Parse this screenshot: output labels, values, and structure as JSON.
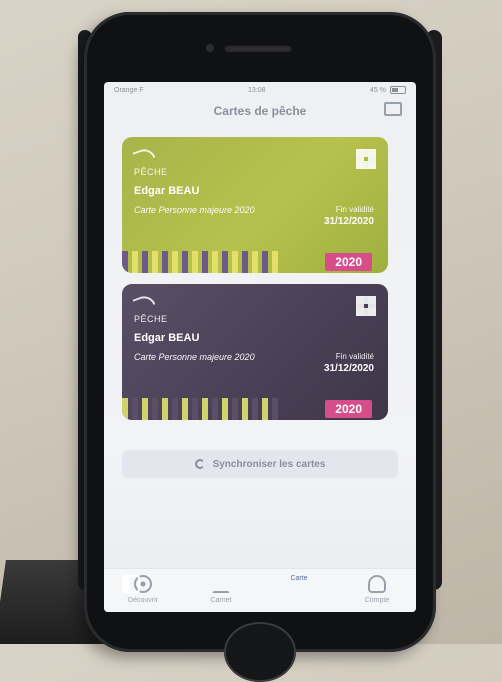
{
  "status_bar": {
    "carrier": "Orange F",
    "time": "13:08",
    "battery": "45 %"
  },
  "nav": {
    "title": "Cartes de pêche",
    "wallet_icon": "wallet-icon"
  },
  "cards": [
    {
      "logo_text": "PÊCHE",
      "name": "Edgar BEAU",
      "type": "Carte Personne majeure 2020",
      "valid_label": "Fin validité",
      "valid_date": "31/12/2020",
      "year": "2020",
      "color": "#b7c14d"
    },
    {
      "logo_text": "PÊCHE",
      "name": "Edgar BEAU",
      "type": "Carte Personne majeure 2020",
      "valid_label": "Fin validité",
      "valid_date": "31/12/2020",
      "year": "2020",
      "color": "#4b4157"
    }
  ],
  "sync": {
    "label": "Synchroniser les cartes"
  },
  "tabs": [
    {
      "label": "Découvrir",
      "icon": "compass-icon",
      "active": false
    },
    {
      "label": "Carnet",
      "icon": "anchor-icon",
      "active": false
    },
    {
      "label": "Carte",
      "icon": "card-icon",
      "active": true
    },
    {
      "label": "Compte",
      "icon": "user-icon",
      "active": false
    }
  ],
  "colors": {
    "accent": "#5b6aa8",
    "badge_pink": "#d74d8a"
  }
}
